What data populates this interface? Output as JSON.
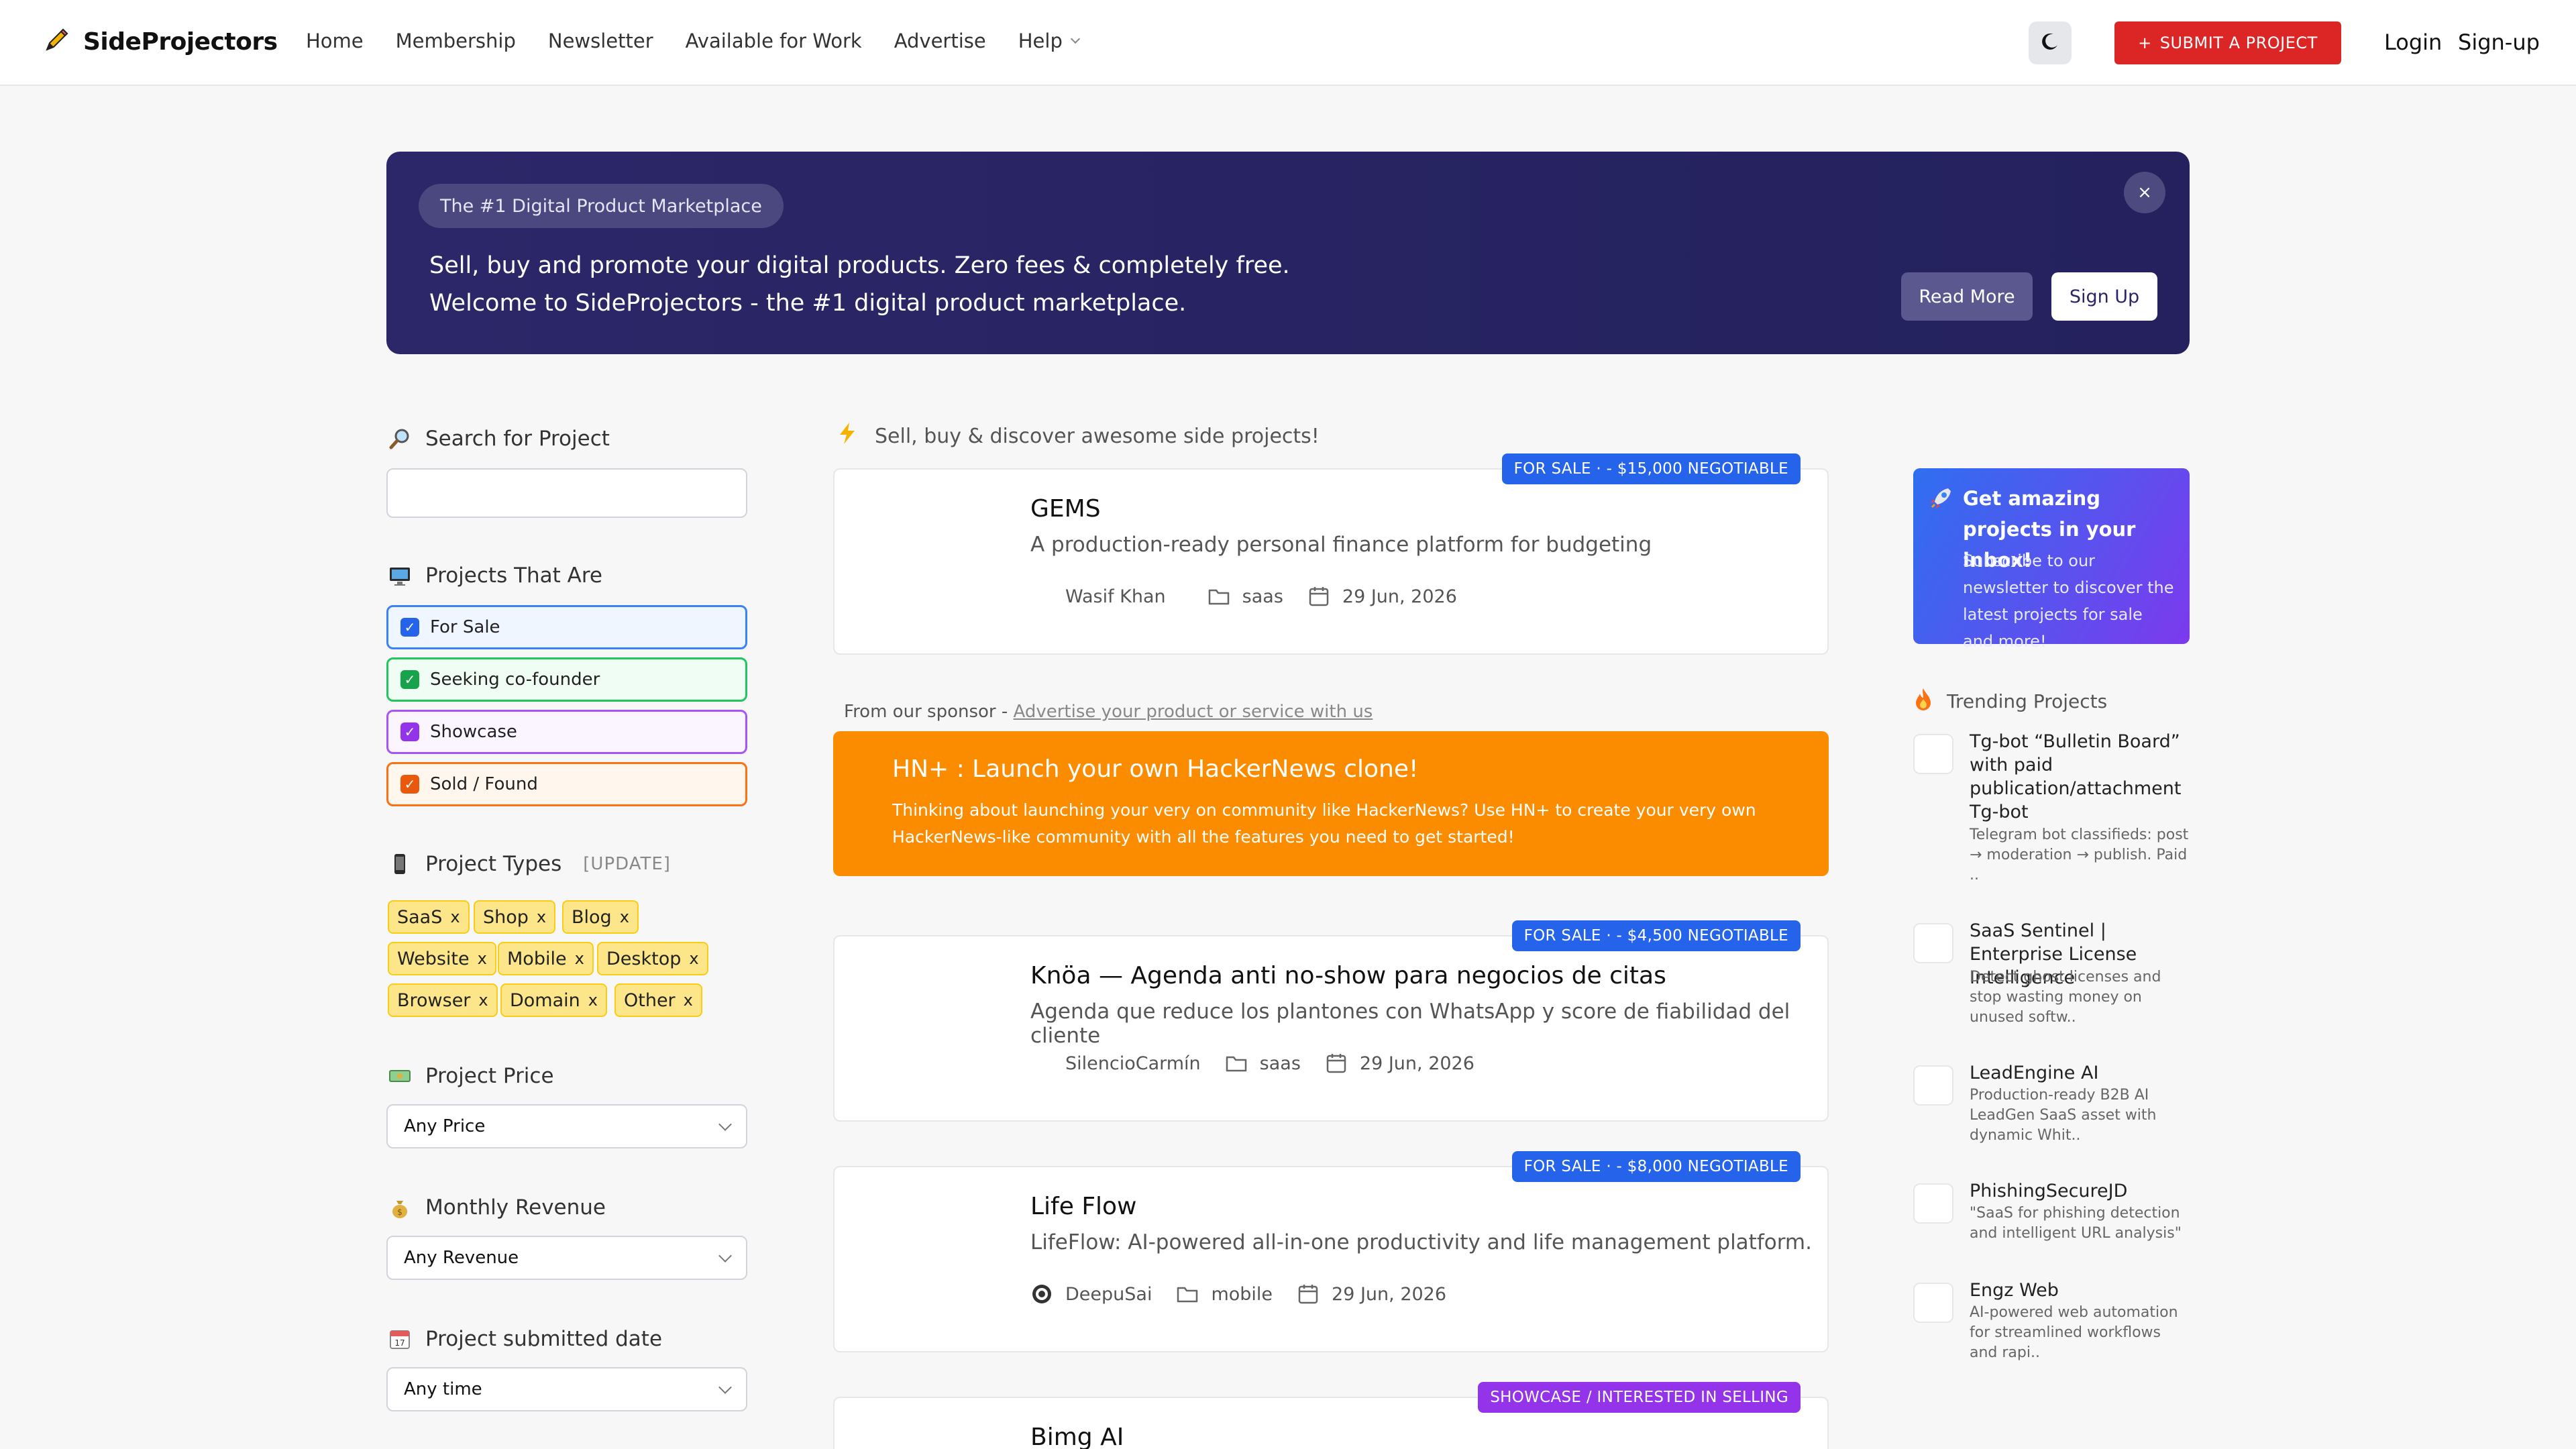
{
  "brand": {
    "name": "SideProjectors"
  },
  "nav": {
    "items": [
      "Home",
      "Membership",
      "Newsletter",
      "Available for Work",
      "Advertise",
      "Help"
    ]
  },
  "header": {
    "submit_label": "SUBMIT A PROJECT",
    "login": "Login",
    "signup": "Sign-up"
  },
  "hero": {
    "pill": "The #1 Digital Product Marketplace",
    "line1": "Sell, buy and promote your digital products. Zero fees & completely free.",
    "line2": "Welcome to SideProjectors - the #1 digital product marketplace.",
    "close": "×",
    "read_more": "Read More",
    "sign_up": "Sign Up"
  },
  "sidebar": {
    "search_title": "Search for Project",
    "search_value": "",
    "status_title": "Projects That Are",
    "statuses": [
      {
        "label": "For Sale",
        "color": "#2563eb",
        "bg": "#eff6ff"
      },
      {
        "label": "Seeking co-founder",
        "color": "#16a34a",
        "bg": "#f0fdf4"
      },
      {
        "label": "Showcase",
        "color": "#9333ea",
        "bg": "#faf5ff"
      },
      {
        "label": "Sold / Found",
        "color": "#ea580c",
        "bg": "#fff7ed"
      }
    ],
    "types_title": "Project Types",
    "types_update": "[UPDATE]",
    "types": [
      "SaaS",
      "Shop",
      "Blog",
      "Website",
      "Mobile",
      "Desktop",
      "Browser",
      "Domain",
      "Other"
    ],
    "tag_close": "x",
    "price_title": "Project Price",
    "price_value": "Any Price",
    "revenue_title": "Monthly Revenue",
    "revenue_value": "Any Revenue",
    "date_title": "Project submitted date",
    "date_value": "Any time"
  },
  "feed": {
    "title": "Sell, buy & discover awesome side projects!",
    "cards": [
      {
        "badge": "FOR SALE  ·  - $15,000 NEGOTIABLE",
        "badge_color": "#2563eb",
        "title": "GEMS",
        "desc": "A production-ready personal finance platform for budgeting",
        "author": "Wasif Khan",
        "category": "saas",
        "date": "29 Jun, 2026"
      },
      {
        "badge": "FOR SALE  ·  - $4,500 NEGOTIABLE",
        "badge_color": "#2563eb",
        "title": "Knöa — Agenda anti no-show para negocios de citas",
        "desc": "Agenda que reduce los plantones con WhatsApp y score de fiabilidad del cliente",
        "author": "SilencioCarmín",
        "category": "saas",
        "date": "29 Jun, 2026"
      },
      {
        "badge": "FOR SALE  ·  - $8,000 NEGOTIABLE",
        "badge_color": "#2563eb",
        "title": "Life Flow",
        "desc": "LifeFlow: AI-powered all-in-one productivity and life management platform.",
        "author": "DeepuSai",
        "category": "mobile",
        "date": "29 Jun, 2026"
      },
      {
        "badge": "SHOWCASE / INTERESTED IN SELLING",
        "badge_color": "#9333ea",
        "title": "Bimg AI"
      }
    ],
    "sponsor_label": "From our sponsor -",
    "sponsor_link": "Advertise your product or service with us",
    "sponsor_title": "HN+ : Launch your own HackerNews clone!",
    "sponsor_desc": "Thinking about launching your very on community like HackerNews? Use HN+ to create your very own HackerNews-like community with all the features you need to get started!"
  },
  "right": {
    "newsletter_title": "Get amazing projects in your inbox!",
    "newsletter_desc": "Subscribe to our newsletter to discover the latest projects for sale and more!",
    "trending_title": "Trending Projects",
    "trending": [
      {
        "name": "Tg-bot “Bulletin Board” with paid publication/attachment Tg-bot",
        "desc": "Telegram bot classifieds: post → moderation → publish. Paid .."
      },
      {
        "name": "SaaS Sentinel | Enterprise License Intelligence",
        "desc": "Detect ghost licenses and stop wasting money on unused softw.."
      },
      {
        "name": "LeadEngine AI",
        "desc": "Production-ready B2B AI LeadGen SaaS asset with dynamic Whit.."
      },
      {
        "name": "PhishingSecureJD",
        "desc": "\"SaaS for phishing detection and intelligent URL analysis\""
      },
      {
        "name": "Engz Web",
        "desc": "AI-powered web automation for streamlined workflows and rapi.."
      }
    ]
  }
}
